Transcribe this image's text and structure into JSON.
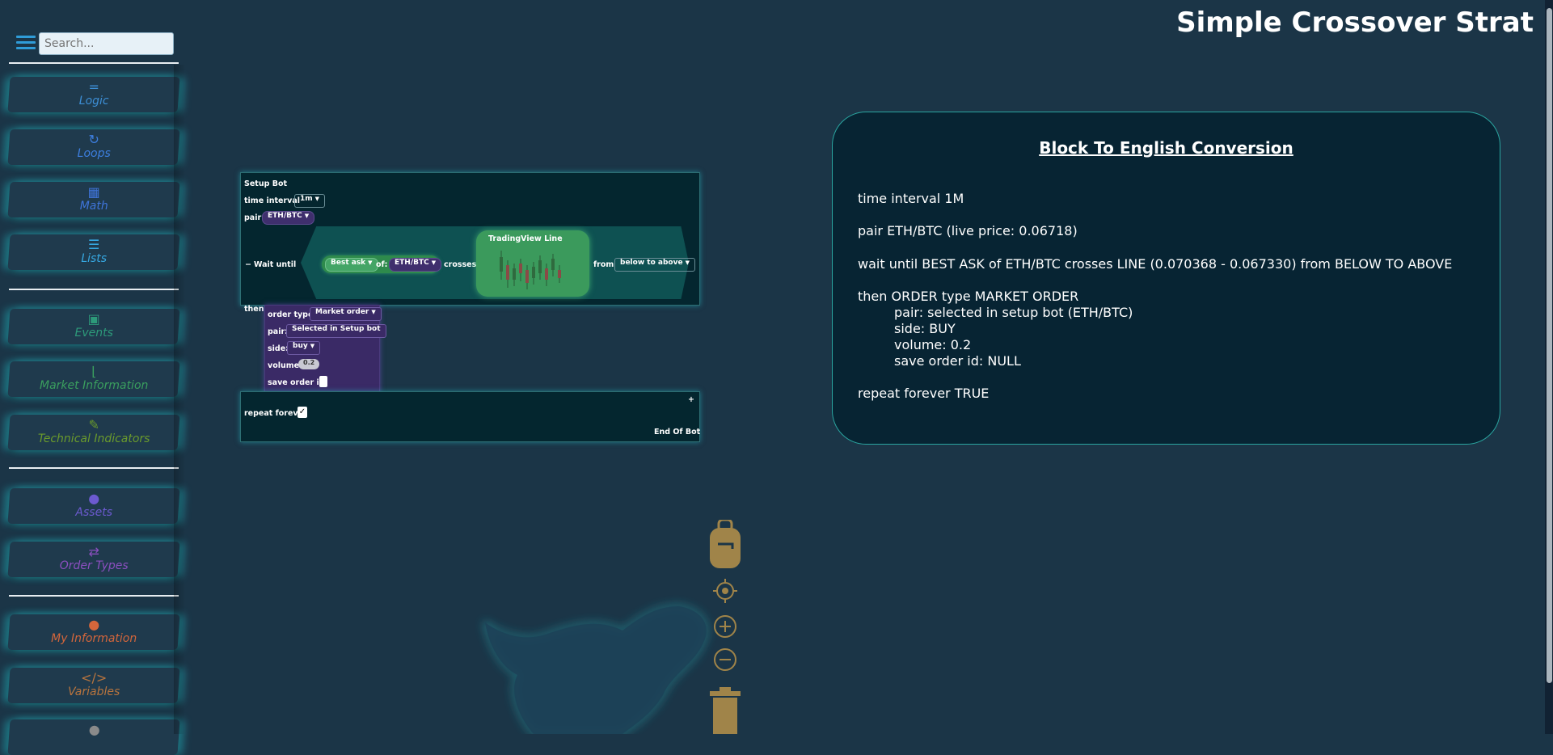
{
  "title": "Simple Crossover Strat",
  "search": {
    "placeholder": "Search..."
  },
  "sidebar": {
    "categories": [
      {
        "label": "Logic",
        "icon": "logic-icon",
        "color": "#3d8fd6"
      },
      {
        "label": "Loops",
        "icon": "loop-icon",
        "color": "#3d7fe0"
      },
      {
        "label": "Math",
        "icon": "calculator-icon",
        "color": "#3f74d9"
      },
      {
        "label": "Lists",
        "icon": "list-icon",
        "color": "#36a7e0"
      },
      {
        "label": "Events",
        "icon": "calendar-icon",
        "color": "#2d9a7a"
      },
      {
        "label": "Market Information",
        "icon": "chart-line-icon",
        "color": "#3a9f5e"
      },
      {
        "label": "Technical Indicators",
        "icon": "wrench-icon",
        "color": "#6a9a2c"
      },
      {
        "label": "Assets",
        "icon": "bitcoin-icon",
        "color": "#6c5ad0"
      },
      {
        "label": "Order Types",
        "icon": "exchange-icon",
        "color": "#8b4fbf"
      },
      {
        "label": "My Information",
        "icon": "user-icon",
        "color": "#d5663b"
      },
      {
        "label": "Variables",
        "icon": "code-icon",
        "color": "#b8743e"
      }
    ]
  },
  "blocks": {
    "setup_label": "Setup Bot",
    "time_interval_label": "time interval",
    "time_interval_value": "1m",
    "pair_label": "pair",
    "pair_value": "ETH/BTC",
    "wait_label": "Wait until",
    "collapse_symbol": "−",
    "price_value": "Best ask",
    "of_label": "of:",
    "of_value": "ETH/BTC",
    "crosses_label": "crosses",
    "tv_title": "TradingView Line",
    "from_label": "from",
    "direction_value": "below to above",
    "then_label": "then",
    "order": {
      "type_label": "order type:",
      "type_value": "Market order",
      "pair_label": "pair:",
      "pair_value": "Selected in Setup bot",
      "side_label": "side:",
      "side_value": "buy",
      "volume_label": "volume",
      "volume_value": "0.2",
      "save_label": "save order id:"
    },
    "plus": "+",
    "repeat_label": "repeat forever",
    "repeat_checked": "✓",
    "end_label": "End Of Bot"
  },
  "english": {
    "heading": "Block To English Conversion",
    "lines": [
      "time interval 1M",
      "pair ETH/BTC (live price: 0.06718)",
      "wait until BEST ASK of ETH/BTC crosses LINE (0.070368 - 0.067330) from BELOW TO ABOVE",
      "then ORDER type MARKET ORDER",
      "pair: selected in setup bot (ETH/BTC)",
      "side: BUY",
      "volume: 0.2",
      "save order id: NULL",
      "repeat forever TRUE"
    ]
  },
  "colors": {
    "background": "#1b3547",
    "accent": "#2aa5a0",
    "tool_gold": "#a08449"
  }
}
